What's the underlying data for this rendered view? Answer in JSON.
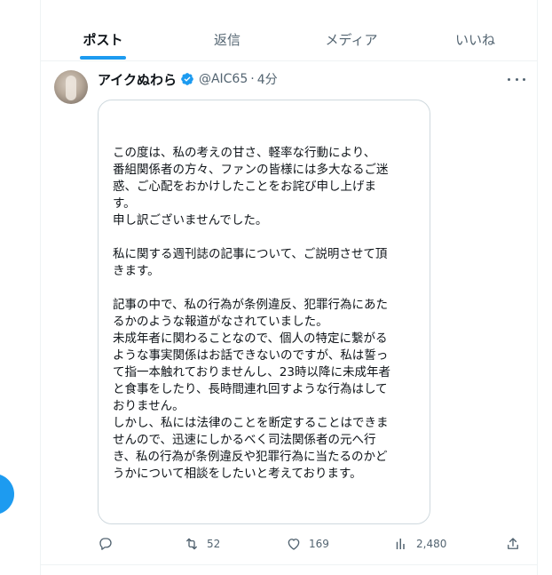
{
  "tabs": [
    {
      "label": "ポスト",
      "active": true
    },
    {
      "label": "返信",
      "active": false
    },
    {
      "label": "メディア",
      "active": false
    },
    {
      "label": "いいね",
      "active": false
    }
  ],
  "post": {
    "name": "アイクぬわら",
    "handle": "@AIC65",
    "separator": "·",
    "time": "4分",
    "image_lines": [
      "この度は、私の考えの甘さ、軽率な行動により、",
      "番組関係者の方々、ファンの皆様には多大なるご迷",
      "惑、ご心配をおかけしたことをお詫び申し上げま",
      "す。",
      "申し訳ございませんでした。",
      "",
      "私に関する週刊誌の記事について、ご説明させて頂",
      "きます。",
      "",
      "記事の中で、私の行為が条例違反、犯罪行為にあた",
      "るかのような報道がなされていました。",
      "未成年者に関わることなので、個人の特定に繋がる",
      "ような事実関係はお話できないのですが、私は誓っ",
      "て指一本触れておりませんし、23時以降に未成年者",
      "と食事をしたり、長時間連れ回すような行為はして",
      "おりません。",
      "しかし、私には法律のことを断定することはできま",
      "せんので、迅速にしかるべく司法関係者の元へ行",
      "き、私の行為が条例違反や犯罪行為に当たるのかど",
      "うかについて相談をしたいと考えております。"
    ],
    "stats": {
      "retweets": "52",
      "likes": "169",
      "views": "2,480"
    }
  },
  "icons": {
    "reply": "reply-icon",
    "retweet": "retweet-icon",
    "like": "heart-icon",
    "views": "views-icon",
    "share": "share-icon",
    "verified": "verified-badge-icon",
    "more": "more-icon"
  },
  "colors": {
    "accent": "#1d9bf0",
    "text": "#0f1419",
    "muted": "#536471",
    "border": "#cfd9de"
  }
}
